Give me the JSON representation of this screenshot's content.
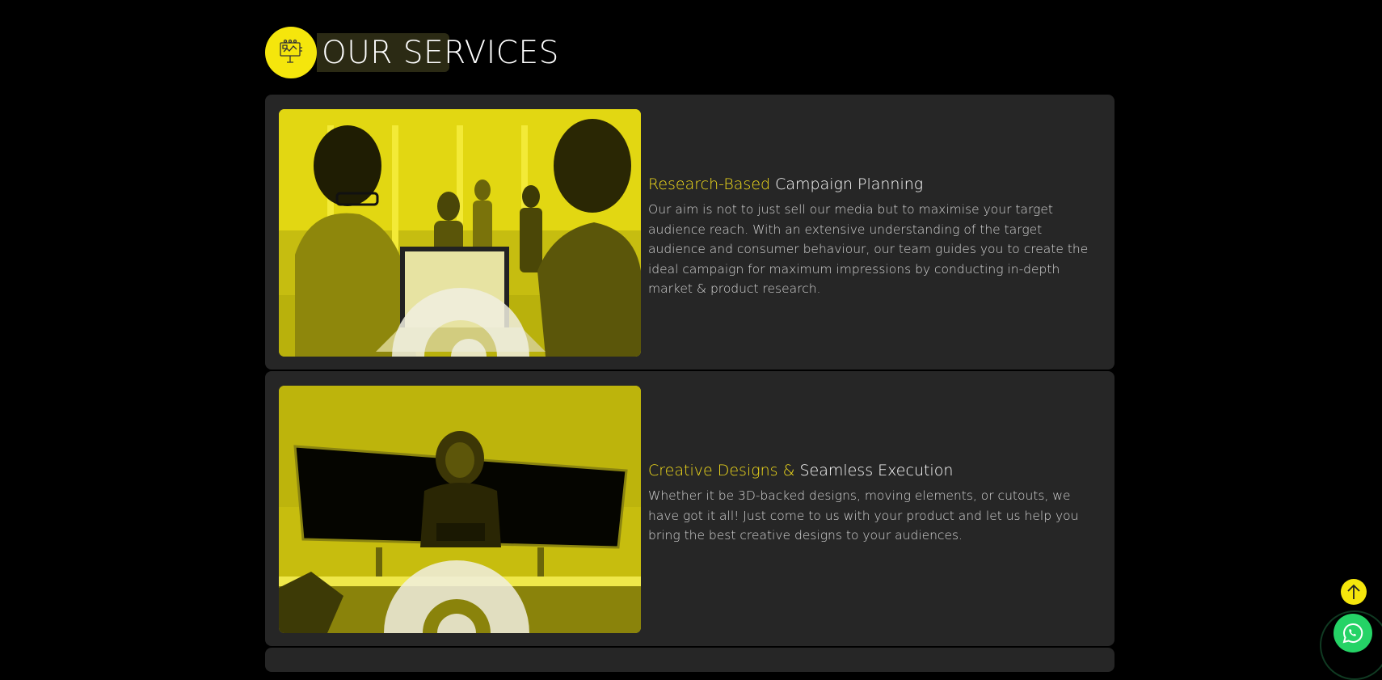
{
  "section": {
    "title": "OUR SERVICES",
    "icon": "billboard-presentation-icon"
  },
  "services": [
    {
      "heading_highlight": "Research-Based",
      "heading_rest": "Campaign Planning",
      "body": "Our aim is not to just sell our media but to maximise your target audience reach. With an extensive understanding of the target audience and consumer behaviour, our team guides you to create the ideal campaign for maximum impressions by conducting in-depth market & product research.",
      "image": "business-meeting-photo"
    },
    {
      "heading_highlight": "Creative Designs &",
      "heading_rest": "Seamless Execution",
      "body": "Whether it be 3D-backed designs, moving elements, or cutouts, we have got it all! Just come to us with your product and let us help you bring the best creative designs to your audiences.",
      "image": "lion-billboard-photo"
    }
  ],
  "floating": {
    "scroll_top_icon": "arrow-up-icon",
    "whatsapp_icon": "whatsapp-icon"
  },
  "colors": {
    "accent": "#f5e60c",
    "highlight_text": "#f2dc1b",
    "card_bg": "#262626",
    "page_bg": "#000000",
    "whatsapp": "#25d366"
  }
}
